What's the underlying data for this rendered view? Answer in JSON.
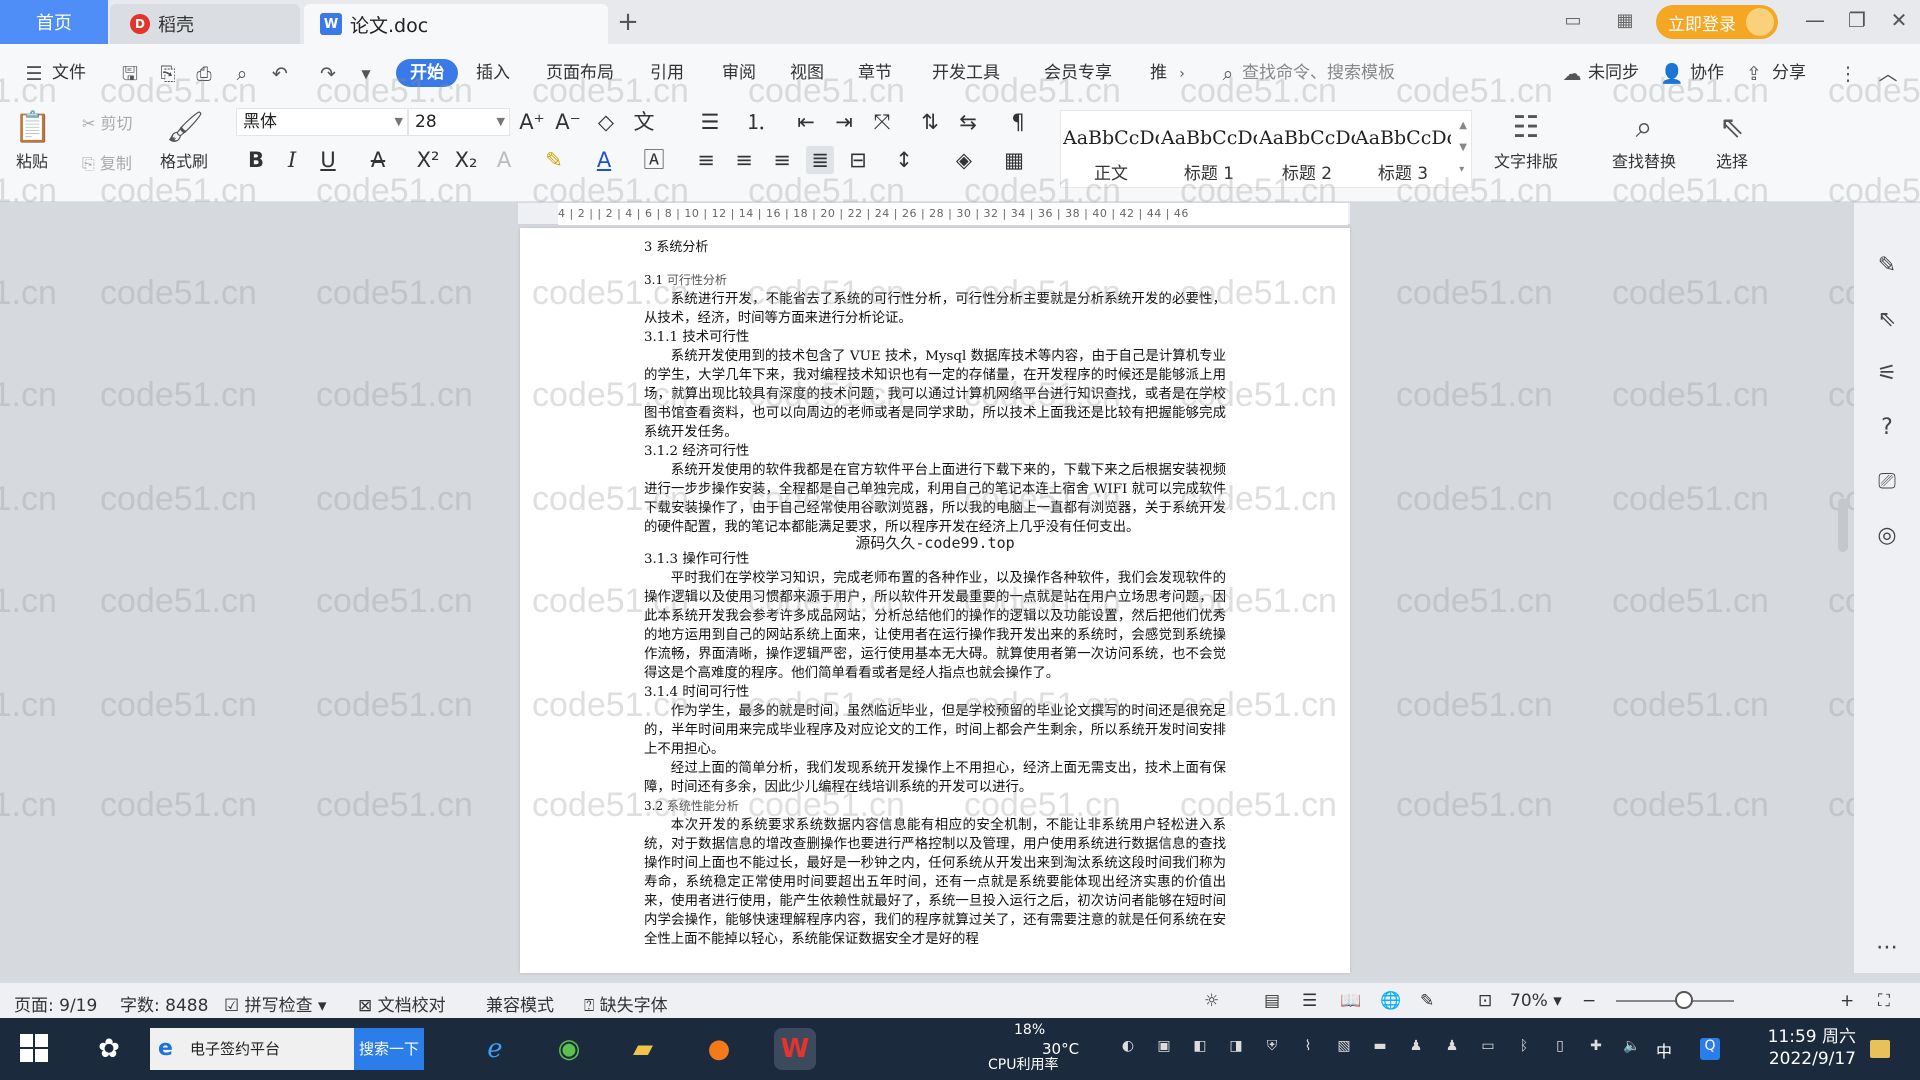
{
  "tabs": {
    "home": "首页",
    "daoke": "稻壳",
    "doc": "论文.doc",
    "add": "+"
  },
  "title_bar": {
    "login": "立即登录"
  },
  "menu": {
    "file": "文件",
    "items": [
      "开始",
      "插入",
      "页面布局",
      "引用",
      "审阅",
      "视图",
      "章节",
      "开发工具",
      "会员专享",
      "推"
    ],
    "search_cmd": "查找命令、搜索模板",
    "sync": "未同步",
    "collab": "协作",
    "share": "分享"
  },
  "ribbon": {
    "paste": "粘贴",
    "cut": "剪切",
    "copy": "复制",
    "format_painter": "格式刷",
    "font_name": "黑体",
    "font_size": "28",
    "styles": [
      {
        "preview": "AaBbCcDd",
        "name": "正文"
      },
      {
        "preview": "AaBbCcDd",
        "name": "标题 1"
      },
      {
        "preview": "AaBbCcDd",
        "name": "标题 2"
      },
      {
        "preview": "AaBbCcDd",
        "name": "标题 3"
      }
    ],
    "text_layout": "文字排版",
    "find_replace": "查找替换",
    "select": "选择"
  },
  "ruler": {
    "ticks": "4 | 2 |    | 2 | 4 | 6 | 8 | 10 | 12 | 14 | 16 | 18 | 20 | 22 | 24 | 26 | 28 | 30 | 32 | 34 | 36 | 38 | 40 | 42 | 44 | 46"
  },
  "document": {
    "h_3": "3  系统分析",
    "h_3_1_num": "3.1",
    "h_3_1": "可行性分析",
    "p_3_1": "系统进行开发，不能省去了系统的可行性分析，可行性分析主要就是分析系统开发的必要性，从技术，经济，时间等方面来进行分析论证。",
    "h_3_1_1": "3.1.1 技术可行性",
    "p_3_1_1": "系统开发使用到的技术包含了 VUE 技术，Mysql 数据库技术等内容，由于自己是计算机专业的学生，大学几年下来，我对编程技术知识也有一定的存储量，在开发程序的时候还是能够派上用场，就算出现比较具有深度的技术问题，我可以通过计算机网络平台进行知识查找，或者是在学校图书馆查看资料，也可以向周边的老师或者是同学求助，所以技术上面我还是比较有把握能够完成系统开发任务。",
    "h_3_1_2": "3.1.2 经济可行性",
    "p_3_1_2": "系统开发使用的软件我都是在官方软件平台上面进行下载下来的，下载下来之后根据安装视频进行一步步操作安装，全程都是自己单独完成，利用自己的笔记本连上宿舍 WIFI 就可以完成软件下载安装操作了，由于自己经常使用谷歌浏览器，所以我的电脑上一直都有浏览器，关于系统开发的硬件配置，我的笔记本都能满足要求，所以程序开发在经济上几乎没有任何支出。",
    "inline_watermark": "源码久久-code99.top",
    "h_3_1_3": "3.1.3 操作可行性",
    "p_3_1_3": "平时我们在学校学习知识，完成老师布置的各种作业，以及操作各种软件，我们会发现软件的操作逻辑以及使用习惯都来源于用户，所以软件开发最重要的一点就是站在用户立场思考问题，因此本系统开发我会参考许多成品网站，分析总结他们的操作的逻辑以及功能设置，然后把他们优秀的地方运用到自己的网站系统上面来，让使用者在运行操作我开发出来的系统时，会感觉到系统操作流畅，界面清晰，操作逻辑严密，运行使用基本无大碍。就算使用者第一次访问系统，也不会觉得这是个高难度的程序。他们简单看看或者是经人指点也就会操作了。",
    "h_3_1_4": "3.1.4  时间可行性",
    "p_3_1_4a": "作为学生，最多的就是时间，虽然临近毕业，但是学校预留的毕业论文撰写的时间还是很充足的，半年时间用来完成毕业程序及对应论文的工作，时间上都会产生剩余，所以系统开发时间安排上不用担心。",
    "p_3_1_4b": "经过上面的简单分析，我们发现系统开发操作上不用担心，经济上面无需支出，技术上面有保障，时间还有多余，因此少儿编程在线培训系统的开发可以进行。",
    "h_3_2_num": "3.2",
    "h_3_2": "系统性能分析",
    "p_3_2": "本次开发的系统要求系统数据内容信息能有相应的安全机制，不能让非系统用户轻松进入系统，对于数据信息的增改查删操作也要进行严格控制以及管理，用户使用系统进行数据信息的查找操作时间上面也不能过长，最好是一秒钟之内，任何系统从开发出来到淘汰系统这段时间我们称为寿命，系统稳定正常使用时间要超出五年时间，还有一点就是系统要能体现出经济实惠的价值出来，使用者进行使用，能产生依赖性就最好了，系统一旦投入运行之后，初次访问者能够在短时间内学会操作，能够快速理解程序内容，我们的程序就算过关了，还有需要注意的就是任何系统在安全性上面不能掉以轻心，系统能保证数据安全才是好的程"
  },
  "watermark_text": "code51.cn",
  "status": {
    "page": "页面: 9/19",
    "words": "字数: 8488",
    "spell": "拼写检查",
    "proof": "文档校对",
    "compat": "兼容模式",
    "missing_font": "缺失字体",
    "zoom": "70%"
  },
  "taskbar": {
    "search_text": "电子签约平台",
    "search_btn": "搜索一下",
    "weather_pct": "18%",
    "weather_temp": "30°C",
    "cpu": "CPU利用率",
    "ime": "中",
    "time": "11:59 周六",
    "date": "2022/9/17"
  },
  "colors": {
    "accent": "#3a7ae8",
    "home_tab": "#4f8ef7",
    "login": "#f5a623",
    "taskbar": "#1c2a3d"
  }
}
